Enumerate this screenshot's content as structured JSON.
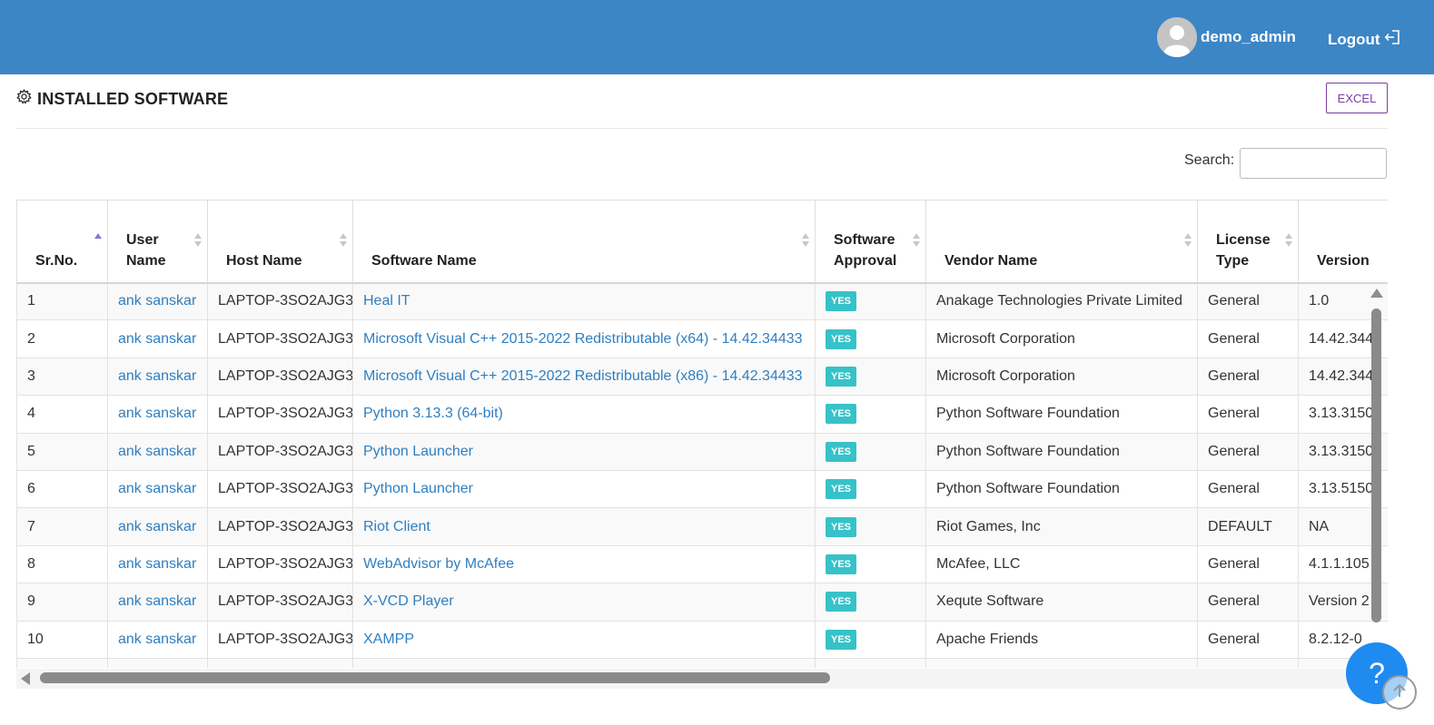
{
  "header": {
    "username": "demo_admin",
    "logout_label": "Logout"
  },
  "page": {
    "title": "INSTALLED SOFTWARE",
    "excel_label": "EXCEL",
    "search_label": "Search:",
    "search_value": ""
  },
  "table": {
    "columns": [
      {
        "line1": "",
        "line2": "Sr.No."
      },
      {
        "line1": "User",
        "line2": "Name"
      },
      {
        "line1": "",
        "line2": "Host Name"
      },
      {
        "line1": "",
        "line2": "Software Name"
      },
      {
        "line1": "Software",
        "line2": "Approval"
      },
      {
        "line1": "",
        "line2": "Vendor Name"
      },
      {
        "line1": "License",
        "line2": "Type"
      },
      {
        "line1": "",
        "line2": "Version"
      }
    ],
    "rows": [
      {
        "sr": "1",
        "user": "ank sanskar",
        "host": "LAPTOP-3SO2AJG3",
        "software": "Heal IT",
        "approval": "YES",
        "vendor": "Anakage Technologies Private Limited",
        "license": "General",
        "version": "1.0"
      },
      {
        "sr": "2",
        "user": "ank sanskar",
        "host": "LAPTOP-3SO2AJG3",
        "software": "Microsoft Visual C++ 2015-2022 Redistributable (x64) - 14.42.34433",
        "approval": "YES",
        "vendor": "Microsoft Corporation",
        "license": "General",
        "version": "14.42.344"
      },
      {
        "sr": "3",
        "user": "ank sanskar",
        "host": "LAPTOP-3SO2AJG3",
        "software": "Microsoft Visual C++ 2015-2022 Redistributable (x86) - 14.42.34433",
        "approval": "YES",
        "vendor": "Microsoft Corporation",
        "license": "General",
        "version": "14.42.344"
      },
      {
        "sr": "4",
        "user": "ank sanskar",
        "host": "LAPTOP-3SO2AJG3",
        "software": "Python 3.13.3 (64-bit)",
        "approval": "YES",
        "vendor": "Python Software Foundation",
        "license": "General",
        "version": "3.13.3150"
      },
      {
        "sr": "5",
        "user": "ank sanskar",
        "host": "LAPTOP-3SO2AJG3",
        "software": "Python Launcher",
        "approval": "YES",
        "vendor": "Python Software Foundation",
        "license": "General",
        "version": "3.13.3150"
      },
      {
        "sr": "6",
        "user": "ank sanskar",
        "host": "LAPTOP-3SO2AJG3",
        "software": "Python Launcher",
        "approval": "YES",
        "vendor": "Python Software Foundation",
        "license": "General",
        "version": "3.13.5150"
      },
      {
        "sr": "7",
        "user": "ank sanskar",
        "host": "LAPTOP-3SO2AJG3",
        "software": "Riot Client",
        "approval": "YES",
        "vendor": "Riot Games, Inc",
        "license": "DEFAULT",
        "version": "NA"
      },
      {
        "sr": "8",
        "user": "ank sanskar",
        "host": "LAPTOP-3SO2AJG3",
        "software": "WebAdvisor by McAfee",
        "approval": "YES",
        "vendor": "McAfee, LLC",
        "license": "General",
        "version": "4.1.1.105"
      },
      {
        "sr": "9",
        "user": "ank sanskar",
        "host": "LAPTOP-3SO2AJG3",
        "software": "X-VCD Player",
        "approval": "YES",
        "vendor": "Xequte Software",
        "license": "General",
        "version": "Version 2"
      },
      {
        "sr": "10",
        "user": "ank sanskar",
        "host": "LAPTOP-3SO2AJG3",
        "software": "XAMPP",
        "approval": "YES",
        "vendor": "Apache Friends",
        "license": "General",
        "version": "8.2.12-0"
      },
      {
        "sr": "",
        "user": "",
        "host": "",
        "software": "",
        "approval": "",
        "vendor": "",
        "license": "",
        "version": ""
      }
    ]
  },
  "help_label": "?",
  "colors": {
    "topbar": "#3c86c6",
    "link": "#2f7fc1",
    "badge": "#36c2c8",
    "excel_border": "#7b3fa0",
    "help_button": "#1f8bf0"
  },
  "icons": {
    "avatar": "user-avatar-icon",
    "logout": "logout-icon",
    "title": "gear-icon",
    "help": "help-icon",
    "scroll_top": "arrow-up-circle-icon"
  }
}
